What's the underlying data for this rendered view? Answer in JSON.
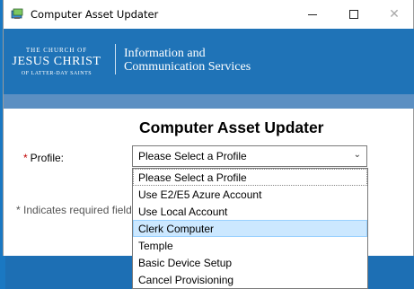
{
  "window": {
    "title": "Computer Asset Updater",
    "minimize_symbol": "—",
    "close_symbol": "✕"
  },
  "banner": {
    "logo_line1": "THE CHURCH OF",
    "logo_line2": "JESUS CHRIST",
    "logo_line3": "OF LATTER-DAY SAINTS",
    "department_line1": "Information and",
    "department_line2": "Communication Services"
  },
  "form": {
    "heading": "Computer Asset Updater",
    "required_marker": "*",
    "profile_label": "Profile:",
    "required_note": "* Indicates required field",
    "profile_select": {
      "selected": "Please Select a Profile",
      "chevron_symbol": "⌄",
      "options": [
        "Please Select a Profile",
        "Use E2/E5 Azure Account",
        "Use Local Account",
        "Clerk Computer",
        "Temple",
        "Basic Device Setup",
        "Cancel Provisioning"
      ],
      "hovered_option": "Clerk Computer"
    }
  },
  "colors": {
    "banner": "#1f73b7",
    "required": "#c00000",
    "hover": "#cce8ff"
  }
}
